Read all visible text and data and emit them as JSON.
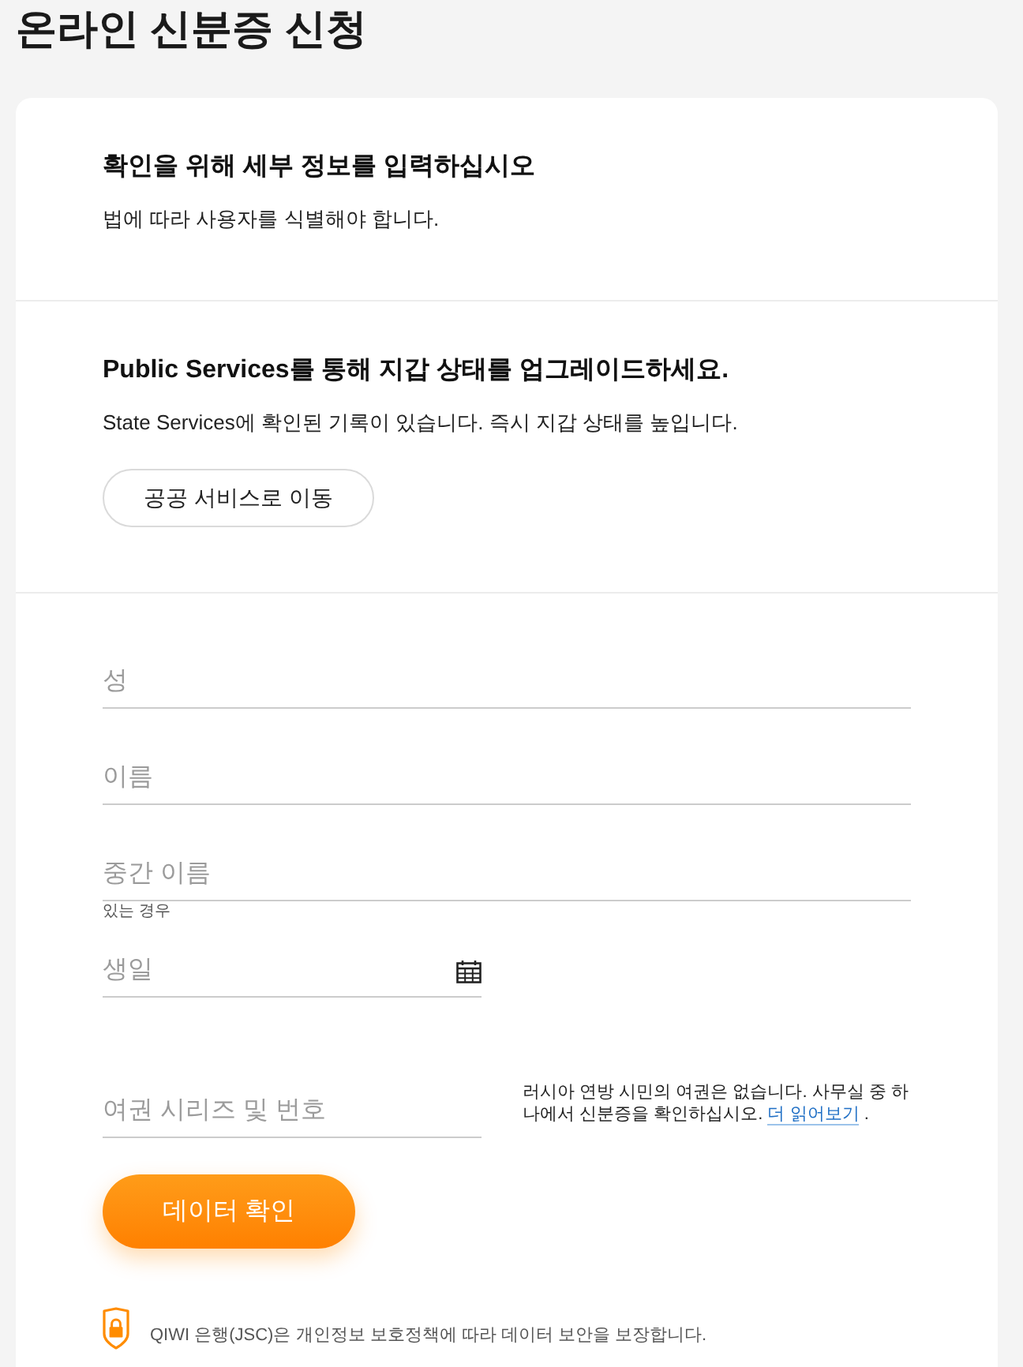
{
  "page": {
    "title": "온라인 신분증 신청"
  },
  "sections": [
    {
      "heading": "확인을 위해 세부 정보를 입력하십시오",
      "text": "법에 따라 사용자를 식별해야 합니다."
    },
    {
      "heading": "Public Services를 통해 지갑 상태를 업그레이드하세요.",
      "text": "State Services에 확인된 기록이 있습니다. 즉시 지갑 상태를 높입니다.",
      "button": "공공 서비스로 이동"
    }
  ],
  "form": {
    "fields": [
      {
        "kind": "text",
        "placeholder": "성"
      },
      {
        "kind": "text",
        "placeholder": "이름"
      },
      {
        "kind": "text",
        "placeholder": "중간 이름",
        "hint": "있는 경우"
      },
      {
        "kind": "date",
        "placeholder": "생일"
      },
      {
        "kind": "document",
        "placeholder": "여권 시리즈 및 번호",
        "note": "러시아 연방 시민의 여권은 없습니다. 사무실 중 하나에서 신분증을 확인하십시오.",
        "note_link": "더 읽어보기",
        "note_end": "."
      }
    ],
    "submit": "데이터 확인"
  },
  "footer": {
    "text": "QIWI 은행(JSC)은 개인정보 보호정책에 따라 데이터 보안을 보장합니다."
  }
}
